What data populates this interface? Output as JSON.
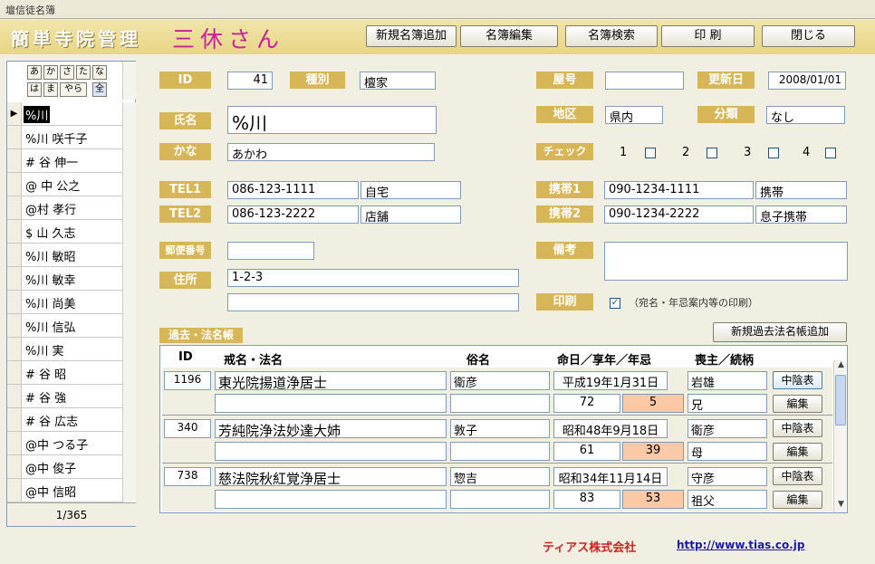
{
  "window": {
    "title": "壇信徒名簿"
  },
  "header": {
    "app_name": "簡単寺院管理",
    "product": "三休さん"
  },
  "toolbar": {
    "new": "新規名簿追加",
    "edit": "名簿編集",
    "search": "名簿検索",
    "print": "印 刷",
    "close": "閉じる"
  },
  "kana": [
    "あ",
    "か",
    "さ",
    "た",
    "な",
    "は",
    "ま",
    "やら",
    "全"
  ],
  "list": {
    "items": [
      "%川",
      "%川 咲千子",
      "# 谷 伸一",
      "@ 中 公之",
      "@村 孝行",
      "$ 山 久志",
      "%川 敏昭",
      "%川 敏幸",
      "%川 尚美",
      "%川 信弘",
      "%川 実",
      "# 谷 昭",
      "# 谷 強",
      "# 谷 広志",
      "@中 つる子",
      "@中 俊子",
      "@中 信昭"
    ],
    "record": "1/365"
  },
  "form": {
    "id_label": "ID",
    "id": "41",
    "type_label": "種別",
    "type": "檀家",
    "yago_label": "屋号",
    "yago": "",
    "updated_label": "更新日",
    "updated": "2008/01/01",
    "name_label": "氏名",
    "name": "%川",
    "area_label": "地区",
    "area": "県内",
    "class_label": "分類",
    "class": "なし",
    "kana_label": "かな",
    "kana": "あかわ",
    "check_label": "チェック",
    "checks": [
      "1",
      "2",
      "3",
      "4"
    ],
    "tel1_label": "TEL1",
    "tel1": "086-123-1111",
    "tel1_note": "自宅",
    "tel2_label": "TEL2",
    "tel2": "086-123-2222",
    "tel2_note": "店舗",
    "mob1_label": "携帯1",
    "mob1": "090-1234-1111",
    "mob1_note": "携帯",
    "mob2_label": "携帯2",
    "mob2": "090-1234-2222",
    "mob2_note": "息子携帯",
    "zip_label": "郵便番号",
    "zip": "",
    "memo_label": "備考",
    "memo": "",
    "addr_label": "住所",
    "addr1": "1-2-3",
    "addr2": "",
    "print_label": "印刷",
    "print_note": "（宛名・年忌案内等の印刷）"
  },
  "history": {
    "title": "過去・法名帳",
    "add_button": "新規過去法名帳追加",
    "headers": {
      "id": "ID",
      "kaimyo": "戒名・法名",
      "zokumyo": "俗名",
      "date": "命日／享年／年忌",
      "relation": "喪主／続柄"
    },
    "records": [
      {
        "id": "1196",
        "kaimyo": "東光院揚道浄居士",
        "zokumyo": "衛彦",
        "date": "平成19年1月31日",
        "age": "72",
        "nenki": "5",
        "chief": "岩雄",
        "relation": "兄"
      },
      {
        "id": "340",
        "kaimyo": "芳純院浄法妙達大姉",
        "zokumyo": "敦子",
        "date": "昭和48年9月18日",
        "age": "61",
        "nenki": "39",
        "chief": "衛彦",
        "relation": "母"
      },
      {
        "id": "738",
        "kaimyo": "慈法院秋紅覚浄居士",
        "zokumyo": "惣吉",
        "date": "昭和34年11月14日",
        "age": "83",
        "nenki": "53",
        "chief": "守彦",
        "relation": "祖父"
      }
    ],
    "btn_table": "中陰表",
    "btn_edit": "編集"
  },
  "footer": {
    "company": "ティアス株式会社",
    "url": "http://www.tias.co.jp"
  },
  "colors": {
    "label": "#d6b656",
    "nenki": "#fbc9a6",
    "product": "#c8209c",
    "company": "#cc2222",
    "url": "#1a1aa8"
  }
}
